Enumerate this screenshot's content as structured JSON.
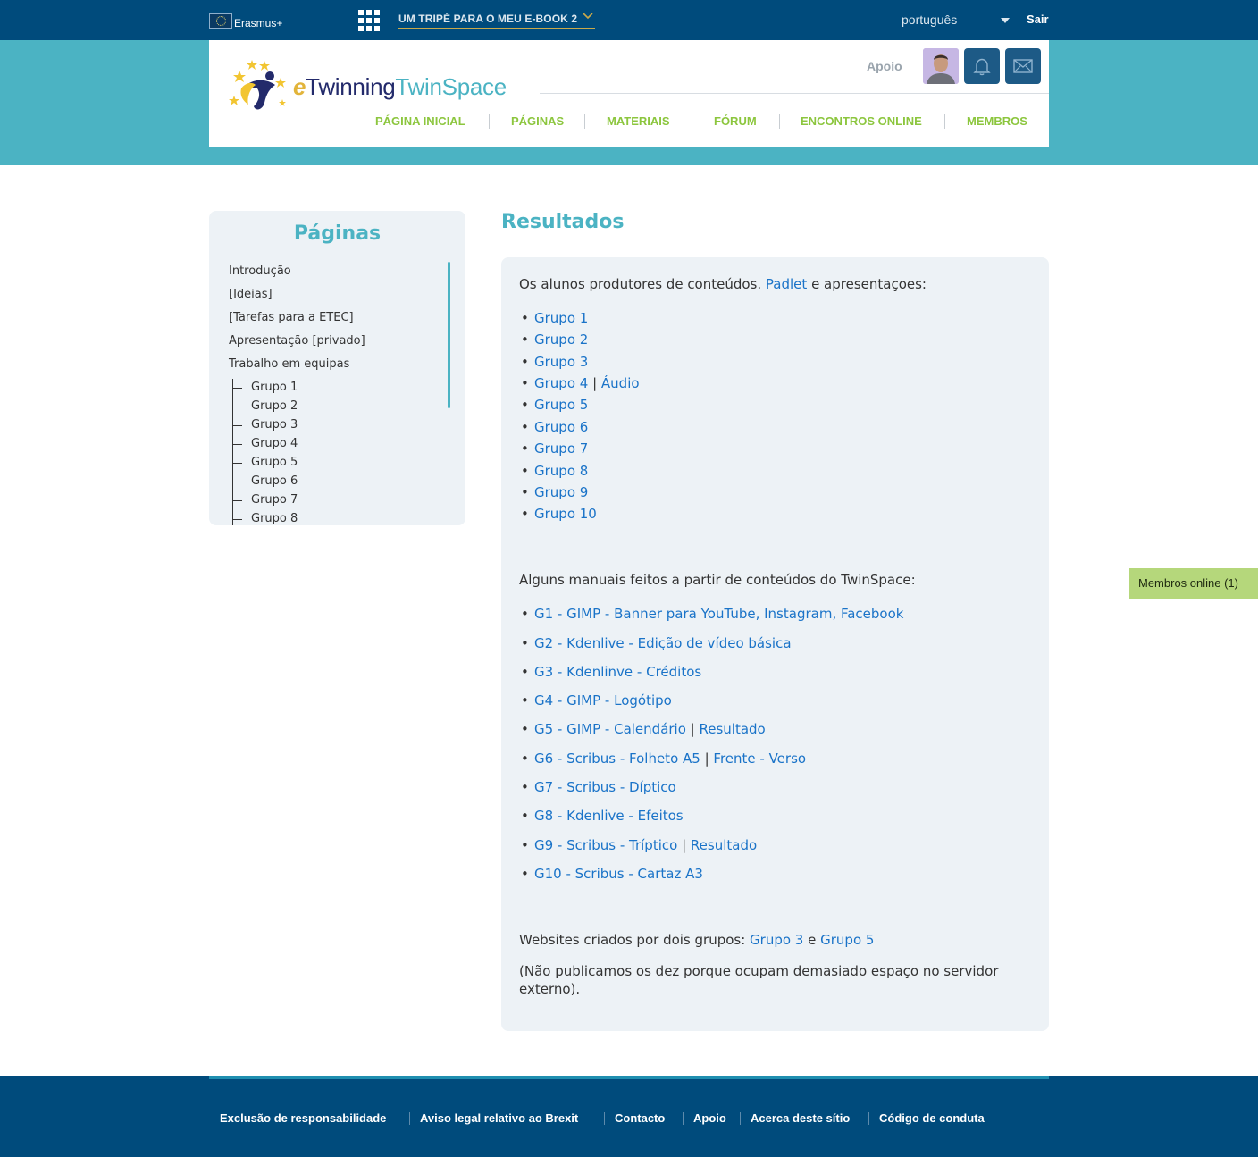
{
  "topbar": {
    "erasmus_label": "Erasmus+",
    "space_title": "UM TRIPÉ PARA O MEU E-BOOK 2",
    "language": "português",
    "logout": "Sair"
  },
  "header": {
    "logo_e": "e",
    "logo_twinning": "Twinning",
    "logo_twinspace": "TwinSpace",
    "support": "Apoio",
    "nav": [
      "PÁGINA INICIAL",
      "PÁGINAS",
      "MATERIAIS",
      "FÓRUM",
      "ENCONTROS ONLINE",
      "MEMBROS"
    ]
  },
  "sidebar": {
    "title": "Páginas",
    "items": [
      "Introdução",
      "[Ideias]",
      "[Tarefas para a ETEC]",
      "Apresentação [privado]",
      "Trabalho em equipas"
    ],
    "subitems": [
      "Grupo 1",
      "Grupo 2",
      "Grupo 3",
      "Grupo 4",
      "Grupo 5",
      "Grupo 6",
      "Grupo 7",
      "Grupo 8"
    ]
  },
  "main": {
    "title": "Resultados",
    "intro_pre": "Os alunos produtores de conteúdos. ",
    "intro_link": "Padlet",
    "intro_post": " e apresentaçoes:",
    "groups": [
      "Grupo 1",
      "Grupo 2",
      "Grupo 3",
      "Grupo 4",
      "Grupo 5",
      "Grupo 6",
      "Grupo 7",
      "Grupo 8",
      "Grupo 9",
      "Grupo 10"
    ],
    "audio_sep": " | ",
    "audio_link": "Áudio",
    "manuals_intro": "Alguns manuais feitos a partir de conteúdos do TwinSpace:",
    "manuals": [
      {
        "link": "G1 - GIMP - Banner para YouTube, Instagram, Facebook",
        "extra": ""
      },
      {
        "link": "G2 - Kdenlive - Edição de vídeo básica",
        "extra": ""
      },
      {
        "link": "G3 - Kdenlinve - Créditos",
        "extra": ""
      },
      {
        "link": "G4 - GIMP - Logótipo",
        "extra": ""
      },
      {
        "link": "G5 - GIMP - Calendário",
        "extra": "Resultado"
      },
      {
        "link": "G6 - Scribus - Folheto A5",
        "extra": "Frente - Verso"
      },
      {
        "link": "G7 - Scribus - Díptico",
        "extra": ""
      },
      {
        "link": "G8 - Kdenlive - Efeitos",
        "extra": ""
      },
      {
        "link": "G9 - Scribus - Tríptico",
        "extra": "Resultado"
      },
      {
        "link": "G10 - Scribus - Cartaz A3",
        "extra": ""
      }
    ],
    "websites_pre": "Websites criados por dois grupos: ",
    "websites_link1": "Grupo 3",
    "websites_mid": " e ",
    "websites_link2": "Grupo 5",
    "note_line1": "(Não publicamos os dez porque ocupam demasiado espaço no servidor",
    "note_line2": "externo)."
  },
  "online_members": "Membros online (1)",
  "footer": {
    "links": [
      "Exclusão de responsabilidade",
      "Aviso legal relativo ao Brexit",
      "Contacto",
      "Apoio",
      "Acerca deste sítio",
      "Código de conduta"
    ]
  },
  "colors": {
    "topbar": "#004b7c",
    "band": "#4bb3c3",
    "nav": "#8cc63e",
    "link": "#1a73c8",
    "panel": "#edf2f6",
    "online_tab": "#b5d77b"
  },
  "icons": {
    "apps": "grid-icon",
    "dropdown": "chevron-down-icon",
    "notifications": "bell-icon",
    "messages": "mail-icon"
  }
}
